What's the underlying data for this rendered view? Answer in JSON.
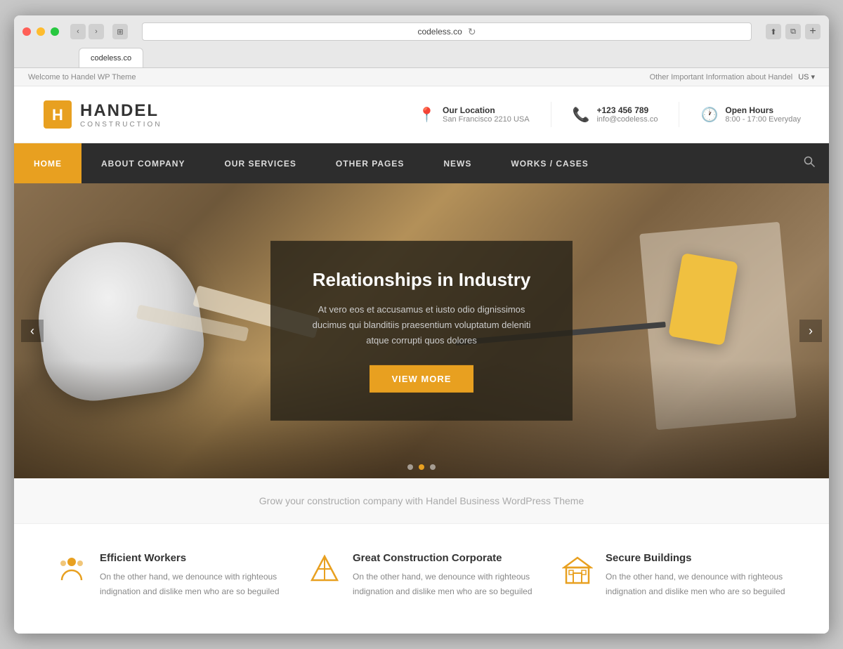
{
  "browser": {
    "url": "codeless.co",
    "tab_label": "codeless.co"
  },
  "top_bar": {
    "left_text": "Welcome to Handel WP Theme",
    "right_text": "Other Important Information about Handel",
    "lang": "US"
  },
  "header": {
    "logo_name": "HANDEL",
    "logo_sub": "CONSTRUCTION",
    "location_label": "Our Location",
    "location_value": "San Francisco 2210 USA",
    "phone_label": "+123 456 789",
    "phone_value": "info@codeless.co",
    "hours_label": "Open Hours",
    "hours_value": "8:00 - 17:00 Everyday"
  },
  "nav": {
    "items": [
      {
        "label": "HOME",
        "active": true
      },
      {
        "label": "ABOUT COMPANY",
        "active": false
      },
      {
        "label": "OUR SERVICES",
        "active": false
      },
      {
        "label": "OTHER PAGES",
        "active": false
      },
      {
        "label": "NEWS",
        "active": false
      },
      {
        "label": "WORKS / CASES",
        "active": false
      }
    ]
  },
  "hero": {
    "title": "Relationships in Industry",
    "description": "At vero eos et accusamus et iusto odio dignissimos ducimus qui blanditiis praesentium voluptatum deleniti atque corrupti quos dolores",
    "button_label": "VIEW MORE",
    "dots": [
      1,
      2,
      3
    ],
    "active_dot": 2
  },
  "tagline": {
    "text": "Grow your construction company with Handel Business WordPress Theme"
  },
  "features": [
    {
      "icon": "👷",
      "title": "Efficient Workers",
      "description": "On the other hand, we denounce with righteous indignation and dislike men who are so beguiled"
    },
    {
      "icon": "⚙",
      "title": "Great Construction Corporate",
      "description": "On the other hand, we denounce with righteous indignation and dislike men who are so beguiled"
    },
    {
      "icon": "🏗",
      "title": "Secure Buildings",
      "description": "On the other hand, we denounce with righteous indignation and dislike men who are so beguiled"
    }
  ]
}
